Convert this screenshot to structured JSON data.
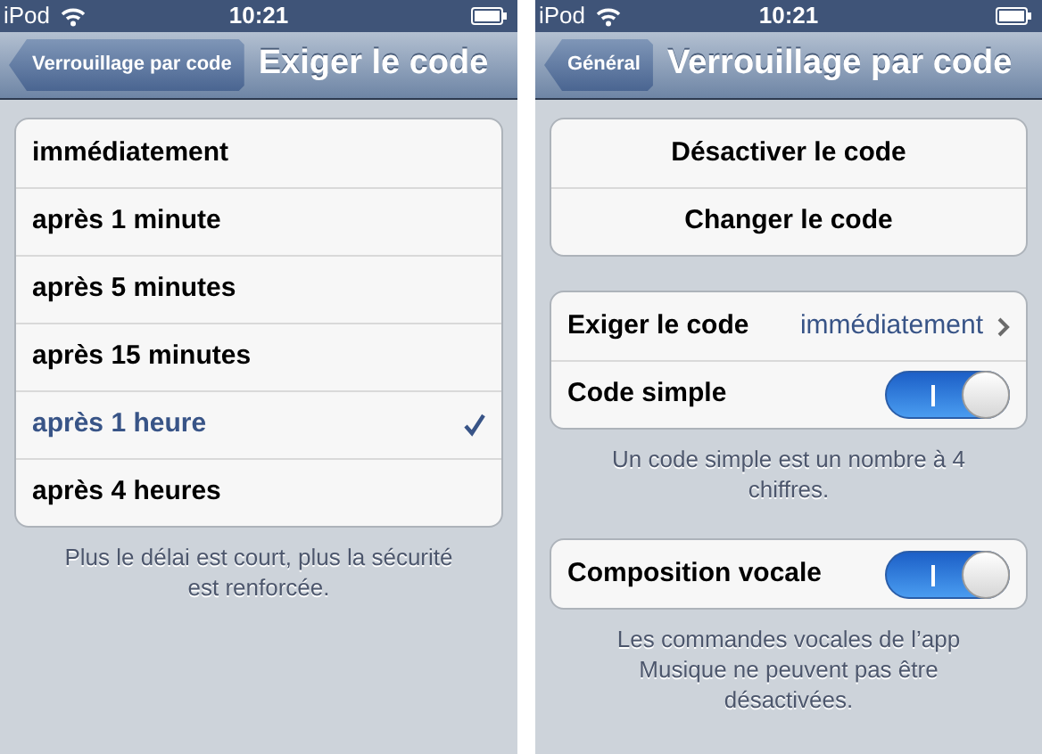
{
  "screens": [
    {
      "status_bar": {
        "carrier": "iPod",
        "time": "10:21"
      },
      "nav_bar": {
        "back": "Verrouillage par code",
        "title": "Exiger le code"
      },
      "sections": [
        {
          "rows": [
            {
              "kind": "option",
              "label": "immédiatement",
              "selected": false
            },
            {
              "kind": "option",
              "label": "après 1 minute",
              "selected": false
            },
            {
              "kind": "option",
              "label": "après 5 minutes",
              "selected": false
            },
            {
              "kind": "option",
              "label": "après 15 minutes",
              "selected": false
            },
            {
              "kind": "option",
              "label": "après 1 heure",
              "selected": true
            },
            {
              "kind": "option",
              "label": "après 4 heures",
              "selected": false
            }
          ],
          "footer": "Plus le délai est court, plus la sécurité est renforcée."
        }
      ]
    },
    {
      "status_bar": {
        "carrier": "iPod",
        "time": "10:21"
      },
      "nav_bar": {
        "back": "Général",
        "title": "Verrouillage par code"
      },
      "sections": [
        {
          "rows": [
            {
              "kind": "button",
              "label": "Désactiver le code"
            },
            {
              "kind": "button",
              "label": "Changer le code"
            }
          ]
        },
        {
          "rows": [
            {
              "kind": "disclosure",
              "label": "Exiger le code",
              "value": "immédiatement"
            },
            {
              "kind": "switch",
              "label": "Code simple",
              "on": true
            }
          ],
          "footer": "Un code simple est un nombre à 4 chiffres."
        },
        {
          "rows": [
            {
              "kind": "switch",
              "label": "Composition vocale",
              "on": true
            }
          ],
          "footer": "Les commandes vocales de l’app Musique ne peuvent pas être désactivées."
        }
      ]
    }
  ]
}
